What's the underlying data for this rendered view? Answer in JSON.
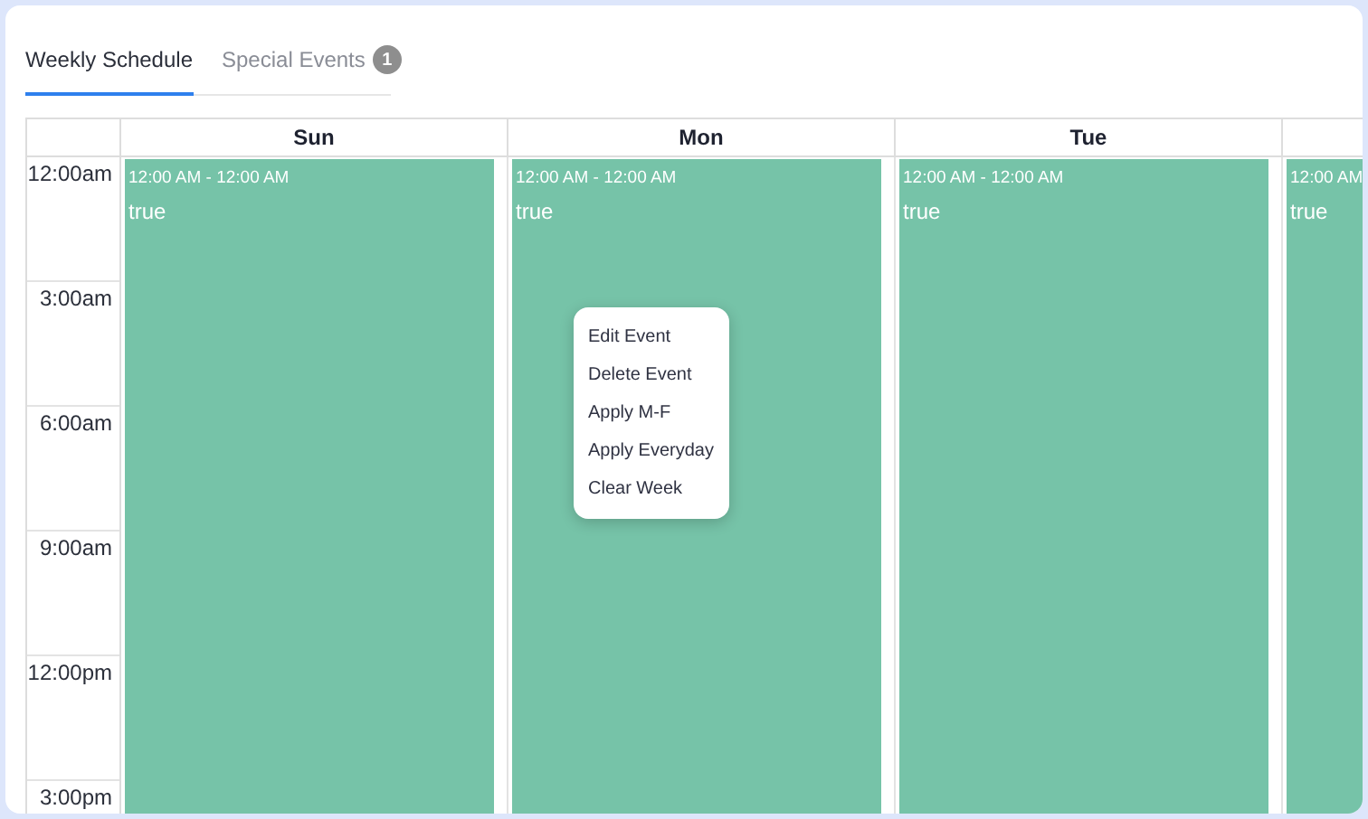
{
  "tabs": [
    {
      "label": "Weekly Schedule",
      "selected": true
    },
    {
      "label": "Special Events",
      "selected": false,
      "badge": "1"
    }
  ],
  "times": [
    "12:00am",
    "3:00am",
    "6:00am",
    "9:00am",
    "12:00pm",
    "3:00pm"
  ],
  "days": [
    {
      "name": "Sun",
      "event": {
        "time": "12:00 AM - 12:00 AM",
        "title": "true"
      }
    },
    {
      "name": "Mon",
      "event": {
        "time": "12:00 AM - 12:00 AM",
        "title": "true"
      }
    },
    {
      "name": "Tue",
      "event": {
        "time": "12:00 AM - 12:00 AM",
        "title": "true"
      }
    },
    {
      "event": {
        "time": "12:00 AM",
        "title": "true"
      }
    }
  ],
  "context_menu": [
    "Edit Event",
    "Delete Event",
    "Apply M-F",
    "Apply Everyday",
    "Clear Week"
  ]
}
